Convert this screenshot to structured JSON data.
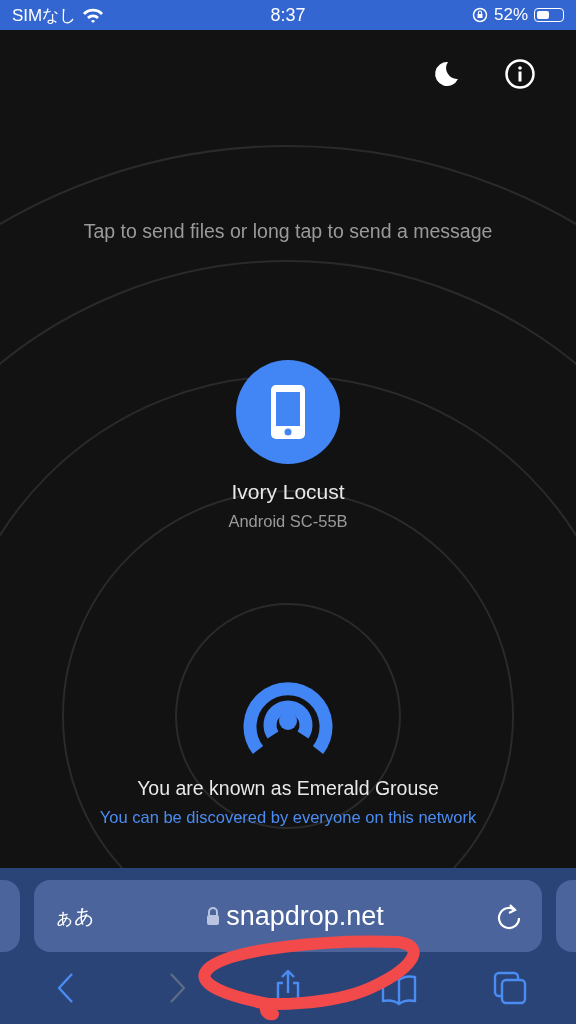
{
  "status_bar": {
    "carrier": "SIMなし",
    "time": "8:37",
    "battery": "52%"
  },
  "header": {
    "buttons": [
      {
        "kind": "theme"
      },
      {
        "kind": "info"
      }
    ]
  },
  "hint": "Tap to send files or long tap to send a message",
  "peers": [
    {
      "name": "Ivory Locust",
      "device": "Android SC-55B"
    }
  ],
  "self": {
    "title": "You are known as Emerald Grouse",
    "subtitle": "You can be discovered by everyone on this network"
  },
  "browser": {
    "text_size_button": "ぁあ",
    "url": "snapdrop.net",
    "toolbar": [
      {
        "kind": "back",
        "disabled": false
      },
      {
        "kind": "forward",
        "disabled": true
      },
      {
        "kind": "share",
        "disabled": false
      },
      {
        "kind": "bookmarks",
        "disabled": false
      },
      {
        "kind": "tabs",
        "disabled": false
      }
    ]
  }
}
